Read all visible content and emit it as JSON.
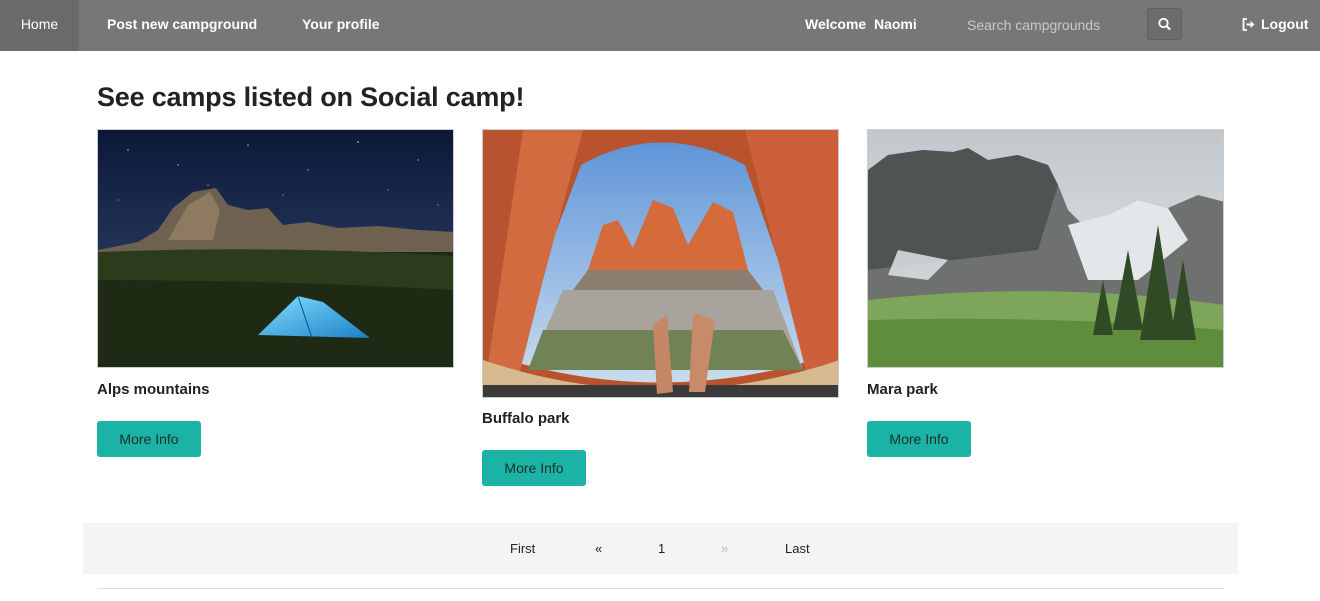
{
  "nav": {
    "home": "Home",
    "post": "Post new campground",
    "profile": "Your profile",
    "welcome": "Welcome  Naomi",
    "search_placeholder": "Search campgrounds",
    "search_icon": "search-icon",
    "logout": "Logout",
    "logout_icon": "sign-out-icon"
  },
  "page": {
    "heading": "See camps listed on Social camp!"
  },
  "camps": [
    {
      "name": "Alps mountains",
      "button": "More Info"
    },
    {
      "name": "Buffalo park",
      "button": "More Info"
    },
    {
      "name": "Mara park",
      "button": "More Info"
    }
  ],
  "pagination": {
    "first": "First",
    "prev": "«",
    "current": "1",
    "next": "»",
    "last": "Last"
  },
  "colors": {
    "navbar": "#777777",
    "accent_button": "#1ab3a6",
    "pager_bg": "#f3f4f5"
  }
}
